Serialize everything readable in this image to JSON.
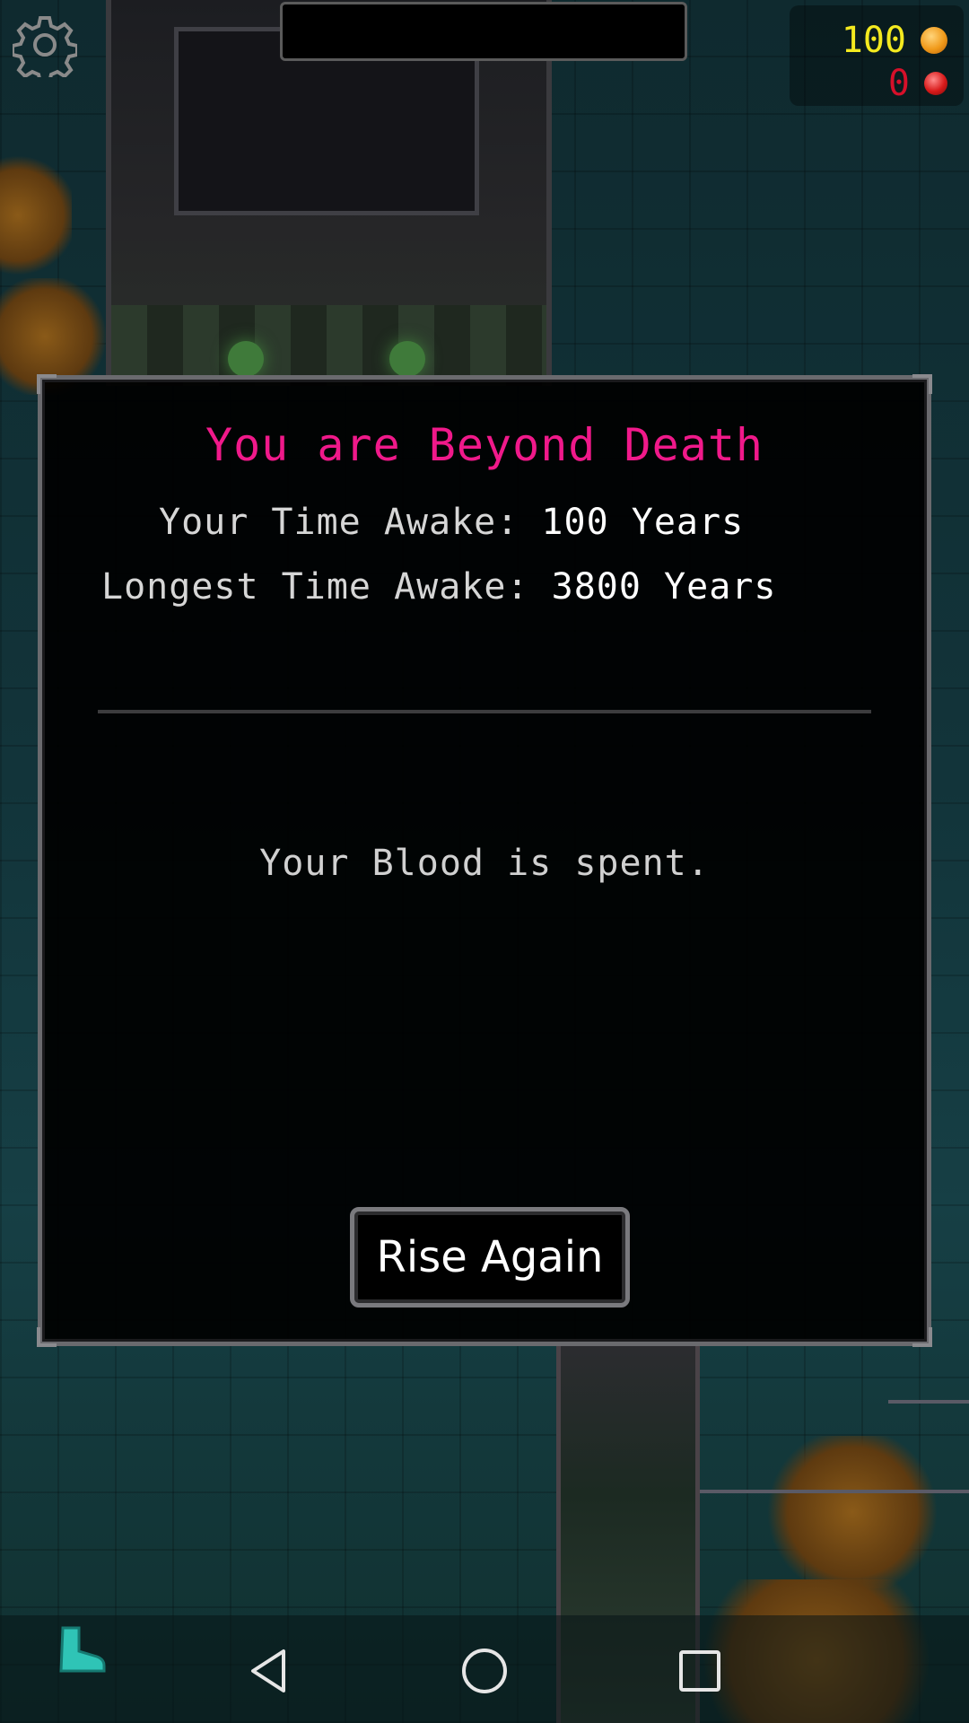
{
  "hud": {
    "gold": "100",
    "blood": "0",
    "gold_color": "#f4ea1f",
    "blood_color": "#d6102a",
    "icons": {
      "settings": "gear-icon",
      "gold": "coin-icon",
      "blood": "blood-drop-icon",
      "inventory": "boot-icon"
    }
  },
  "dialog": {
    "title": "You are Beyond Death",
    "title_color": "#f0198a",
    "current_label": "Your Time Awake: ",
    "current_value": "100 Years",
    "longest_label": "Longest Time Awake: ",
    "longest_value": "3800 Years",
    "message": "Your Blood is spent.",
    "button_label": "Rise Again"
  },
  "nav": {
    "icons": [
      "back-icon",
      "home-icon",
      "recent-apps-icon"
    ]
  }
}
